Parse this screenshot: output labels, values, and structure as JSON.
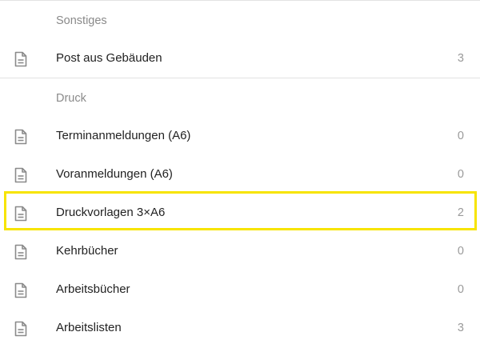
{
  "sections": [
    {
      "header": "Sonstiges",
      "items": [
        {
          "label": "Post aus Gebäuden",
          "count": "3",
          "icon": "document-icon"
        }
      ]
    },
    {
      "header": "Druck",
      "items": [
        {
          "label": "Terminanmeldungen (A6)",
          "count": "0",
          "icon": "document-icon"
        },
        {
          "label": "Voranmeldungen (A6)",
          "count": "0",
          "icon": "document-icon"
        },
        {
          "label": "Druckvorlagen 3×A6",
          "count": "2",
          "icon": "document-icon",
          "highlighted": true
        },
        {
          "label": "Kehrbücher",
          "count": "0",
          "icon": "document-icon"
        },
        {
          "label": "Arbeitsbücher",
          "count": "0",
          "icon": "document-icon"
        },
        {
          "label": "Arbeitslisten",
          "count": "3",
          "icon": "document-icon"
        }
      ]
    }
  ],
  "colors": {
    "highlight_border": "#f7e400",
    "divider": "#e3e3e3",
    "icon": "#8a8a8a",
    "header_text": "#8a8a8a",
    "count_text": "#9a9a9a"
  }
}
